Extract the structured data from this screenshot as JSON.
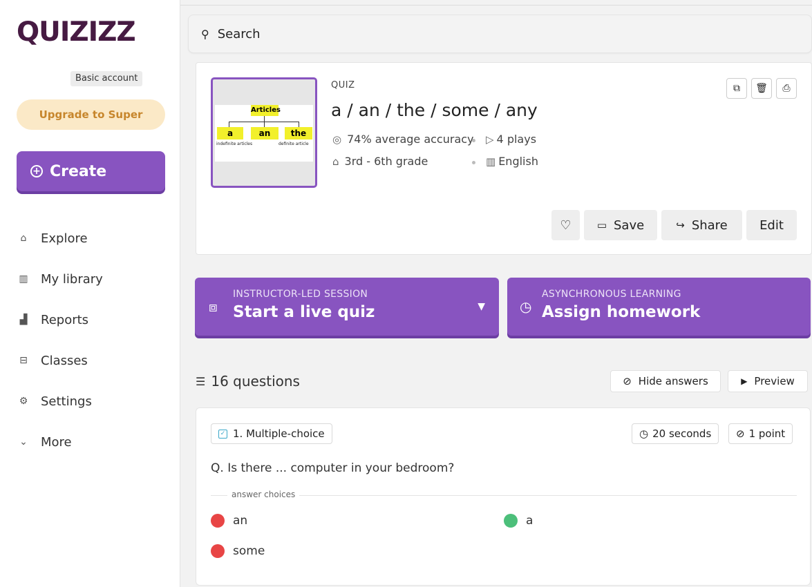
{
  "brand": {
    "logo_text": "QUIZIZZ"
  },
  "sidebar": {
    "account_badge": "Basic account",
    "upgrade_label": "Upgrade to Super",
    "create_label": "Create",
    "items": [
      {
        "label": "Explore",
        "icon": "explore-icon"
      },
      {
        "label": "My library",
        "icon": "library-icon"
      },
      {
        "label": "Reports",
        "icon": "reports-icon"
      },
      {
        "label": "Classes",
        "icon": "classes-icon"
      },
      {
        "label": "Settings",
        "icon": "settings-icon"
      },
      {
        "label": "More",
        "icon": "chevron-down-icon"
      }
    ]
  },
  "search": {
    "placeholder": "Search"
  },
  "quiz": {
    "type_label": "QUIZ",
    "title": "a / an / the / some / any",
    "accuracy": "74% average accuracy",
    "plays": "4 plays",
    "grade": "3rd - 6th grade",
    "language": "English",
    "thumbnail": {
      "heading": "Articles",
      "boxes": [
        "a",
        "an",
        "the"
      ],
      "left_caption": "indefinite articles",
      "right_caption": "definite article"
    },
    "actions": {
      "save": "Save",
      "share": "Share",
      "edit": "Edit"
    }
  },
  "sessions": {
    "live": {
      "kicker": "INSTRUCTOR-LED SESSION",
      "title": "Start a live quiz"
    },
    "homework": {
      "kicker": "ASYNCHRONOUS LEARNING",
      "title": "Assign homework"
    }
  },
  "questions": {
    "count_label": "16 questions",
    "hide_answers": "Hide answers",
    "preview": "Preview",
    "items": [
      {
        "type": "1. Multiple-choice",
        "time": "20 seconds",
        "points": "1 point",
        "text": "Q. Is there ... computer in your bedroom?",
        "choices_label": "answer choices",
        "choices": [
          {
            "text": "an",
            "correct": false
          },
          {
            "text": "a",
            "correct": true
          },
          {
            "text": "some",
            "correct": false
          }
        ]
      }
    ]
  },
  "colors": {
    "brand_purple": "#8854c0",
    "logo": "#461a42",
    "upgrade_bg": "#fbe9c7",
    "upgrade_text": "#c7862c",
    "correct": "#4cbf7a",
    "incorrect": "#e84545"
  }
}
